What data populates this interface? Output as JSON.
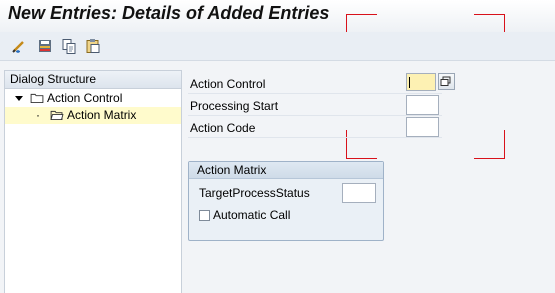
{
  "header": {
    "title": "New Entries: Details of Added Entries"
  },
  "toolbar": {
    "icons": [
      "edit-icon",
      "save-variant-icon",
      "copy-icon",
      "paste-icon"
    ]
  },
  "dialog_structure": {
    "heading": "Dialog Structure",
    "items": [
      {
        "label": "Action Control",
        "expanded": true,
        "selected": false
      },
      {
        "label": "Action Matrix",
        "selected": true
      }
    ]
  },
  "form": {
    "action_control_label": "Action Control",
    "processing_start_label": "Processing Start",
    "action_code_label": "Action Code",
    "action_control_value": "",
    "processing_start_value": "",
    "action_code_value": ""
  },
  "action_matrix": {
    "heading": "Action Matrix",
    "target_status_label": "TargetProcessStatus",
    "target_status_value": "",
    "automatic_call_label": "Automatic Call",
    "automatic_call_checked": false
  },
  "colors": {
    "accent_red": "#d8111b",
    "selected_row": "#fffbcc",
    "active_input": "#fdf1b3"
  }
}
